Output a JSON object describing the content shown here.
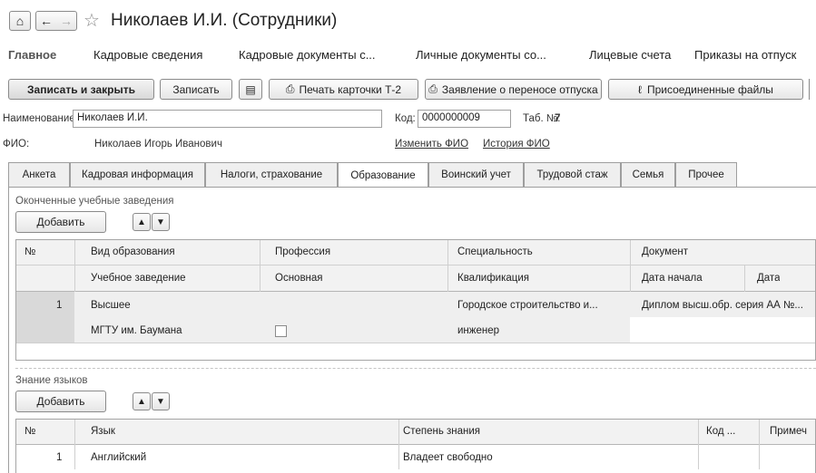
{
  "window": {
    "title": "Николаев И.И. (Сотрудники)"
  },
  "topnav": {
    "items": [
      "Главное",
      "Кадровые сведения",
      "Кадровые документы с...",
      "Личные документы со...",
      "Лицевые счета",
      "Приказы на отпуск"
    ]
  },
  "toolbar": {
    "save_close": "Записать и закрыть",
    "save": "Записать",
    "print_t2": "Печать карточки Т-2",
    "vacation_app": "Заявление о переносе отпуска",
    "attached_files": "Присоединенные файлы"
  },
  "form": {
    "name_label": "Наименование:",
    "name_value": "Николаев И.И.",
    "code_label": "Код:",
    "code_value": "0000000009",
    "tab_no_label": "Таб. №:",
    "tab_no_value": "7",
    "fio_label": "ФИО:",
    "fio_value": "Николаев Игорь Иванович",
    "change_fio": "Изменить ФИО",
    "fio_history": "История ФИО"
  },
  "tabs": [
    "Анкета",
    "Кадровая информация",
    "Налоги, страхование",
    "Образование",
    "Воинский учет",
    "Трудовой стаж",
    "Семья",
    "Прочее"
  ],
  "education": {
    "section_title": "Оконченные учебные заведения",
    "add_label": "Добавить",
    "headers_row1": [
      "№",
      "Вид образования",
      "Профессия",
      "Специальность",
      "Документ"
    ],
    "headers_row2": [
      "Учебное заведение",
      "Основная",
      "Квалификация",
      "Дата начала",
      "Дата"
    ],
    "rows": [
      {
        "num": "1",
        "type": "Высшее",
        "profession": "",
        "specialty": "Городское строительство и...",
        "document": "Диплом высш.обр. серия АА №...",
        "institution": "МГТУ им. Баумана",
        "main_checked": false,
        "qualification": "инженер"
      }
    ]
  },
  "languages": {
    "section_title": "Знание языков",
    "add_label": "Добавить",
    "headers": [
      "№",
      "Язык",
      "Степень знания",
      "Код ...",
      "Примеч"
    ],
    "rows": [
      {
        "num": "1",
        "language": "Английский",
        "level": "Владеет свободно"
      }
    ]
  }
}
